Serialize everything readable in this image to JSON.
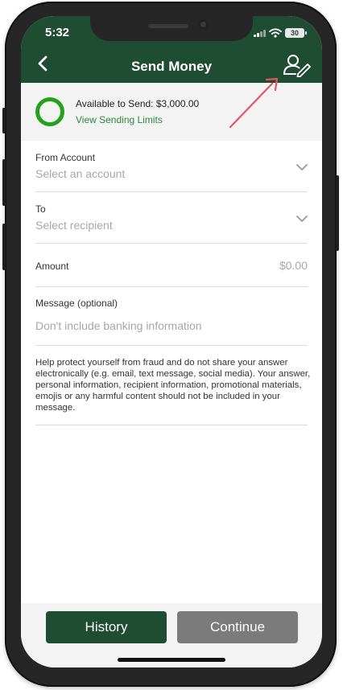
{
  "status_bar": {
    "time": "5:32",
    "battery_level": "30"
  },
  "header": {
    "title": "Send Money"
  },
  "icons": {
    "back": "chevron-left-icon",
    "recipient_edit": "person-pencil-icon",
    "chevron": "chevron-down-icon"
  },
  "available": {
    "text": "Available to Send: $3,000.00",
    "link": "View Sending Limits"
  },
  "form": {
    "from_account": {
      "label": "From Account",
      "placeholder": "Select an account"
    },
    "to": {
      "label": "To",
      "placeholder": "Select recipient"
    },
    "amount": {
      "label": "Amount",
      "value": "$0.00"
    },
    "message": {
      "label": "Message (optional)",
      "placeholder": "Don't include banking information"
    }
  },
  "help_text": "Help protect yourself from fraud and do not share your answer electronically (e.g. email, text message, social media). Your answer, personal information, recipient information, promotional materials, emojis or any harmful content should not be included in your message.",
  "buttons": {
    "history": "History",
    "continue": "Continue"
  },
  "colors": {
    "brand_green": "#1e4d33",
    "ring_green": "#24a21e",
    "link_green": "#2a8a3a",
    "disabled_gray": "#7b7b7b",
    "annotation_arrow": "#e8545f"
  }
}
